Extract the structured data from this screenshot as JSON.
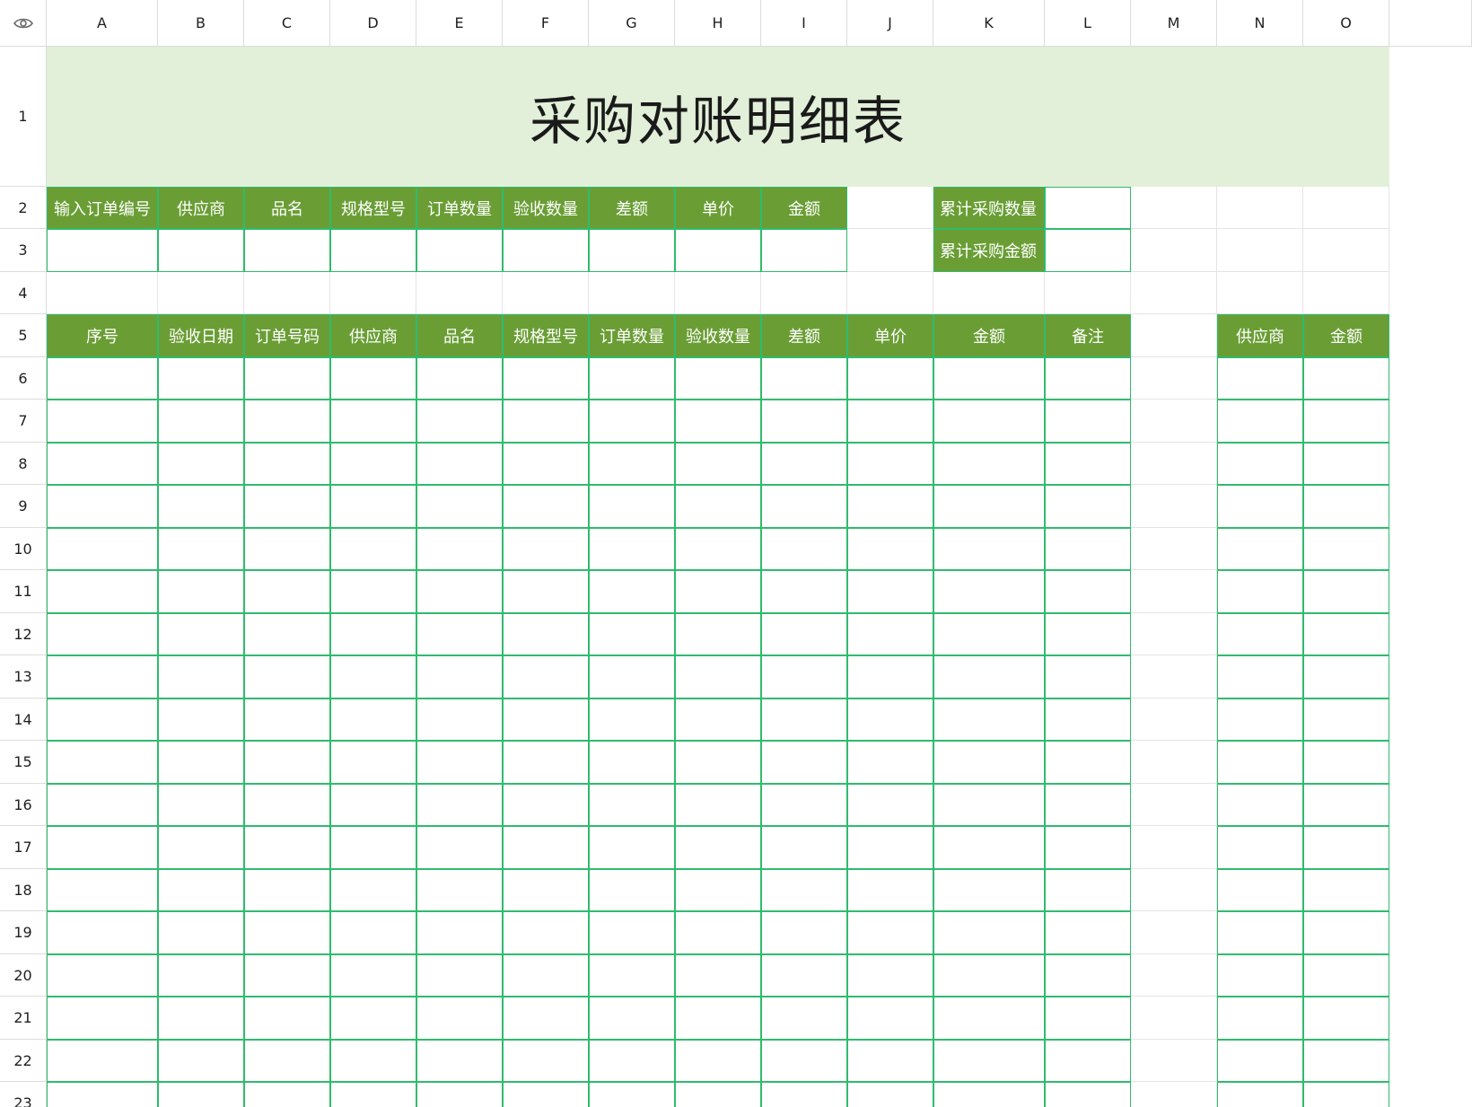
{
  "toolbar": {
    "visibility_icon": "eye-icon"
  },
  "columns": [
    "A",
    "B",
    "C",
    "D",
    "E",
    "F",
    "G",
    "H",
    "I",
    "J",
    "K",
    "L",
    "M",
    "N",
    "O"
  ],
  "rows": [
    "1",
    "2",
    "3",
    "4",
    "5",
    "6",
    "7",
    "8",
    "9",
    "10",
    "11",
    "12",
    "13",
    "14",
    "15",
    "16",
    "17",
    "18",
    "19",
    "20",
    "21",
    "22",
    "23"
  ],
  "sheet": {
    "title": "采购对账明细表",
    "query_headers": [
      "输入订单编号",
      "供应商",
      "品名",
      "规格型号",
      "订单数量",
      "验收数量",
      "差额",
      "单价",
      "金额"
    ],
    "summary_labels": [
      "累计采购数量",
      "累计采购金额"
    ],
    "detail_headers": [
      "序号",
      "验收日期",
      "订单号码",
      "供应商",
      "品名",
      "规格型号",
      "订单数量",
      "验收数量",
      "差额",
      "单价",
      "金额",
      "备注"
    ],
    "side_headers": [
      "供应商",
      "金额"
    ]
  },
  "colors": {
    "header_green": "#6a9e35",
    "title_background": "#e2efd9",
    "table_border": "#2fbb6d",
    "grid_line": "#e4e4e4"
  }
}
